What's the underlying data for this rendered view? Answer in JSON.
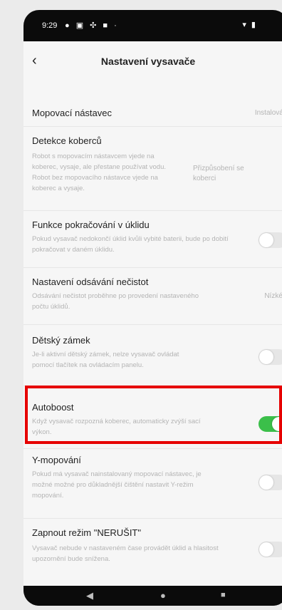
{
  "status_bar": {
    "time": "9:29",
    "left_icons": "● ▣ ✣ ■ ·",
    "right_icons": "▾ ▮"
  },
  "header": {
    "title": "Nastavení vysavače",
    "back_icon": "‹"
  },
  "rows": [
    {
      "title": "Mopovací nástavec",
      "value": "Instalováno"
    },
    {
      "title": "Detekce koberců",
      "description": "Robot s mopovacím nástavcem vjede na koberec, vysaje, ale přestane používat vodu. Robot bez mopovacího nástavce vjede na koberec a vysaje.",
      "value": "Přizpůsobení se koberci"
    },
    {
      "title": "Funkce pokračování v úklidu",
      "description": "Pokud vysavač nedokončí úklid kvůli vybité baterii, bude po dobití pokračovat v daném úklidu.",
      "toggle": false
    },
    {
      "title": "Nastavení odsávání nečistot",
      "description": "Odsávání nečistot proběhne po provedení nastaveného počtu úklidů.",
      "value": "Nízké ›"
    },
    {
      "title": "Dětský zámek",
      "description": "Je-li aktivní dětský zámek, nelze vysavač ovládat pomocí tlačítek na ovládacím panelu.",
      "toggle": false
    },
    {
      "title": "Autoboost",
      "description": "Když vysavač rozpozná koberec, automaticky zvýší sací výkon.",
      "toggle": true
    },
    {
      "title": "Y-mopování",
      "description": "Pokud má vysavač nainstalovaný mopovací nástavec, je možné možné pro důkladnější čištění nastavit Y-režim mopování.",
      "toggle": false
    },
    {
      "title": "Zapnout režim \"NERUŠIT\"",
      "description": "Vysavač nebude v nastaveném čase provádět úklid a hlasitost upozornění bude snížena.",
      "toggle": false
    }
  ],
  "nav": {
    "back": "◀",
    "home": "●",
    "recents": "■"
  },
  "colors": {
    "toggle_on": "#3bbf4a",
    "highlight": "#e60000"
  }
}
